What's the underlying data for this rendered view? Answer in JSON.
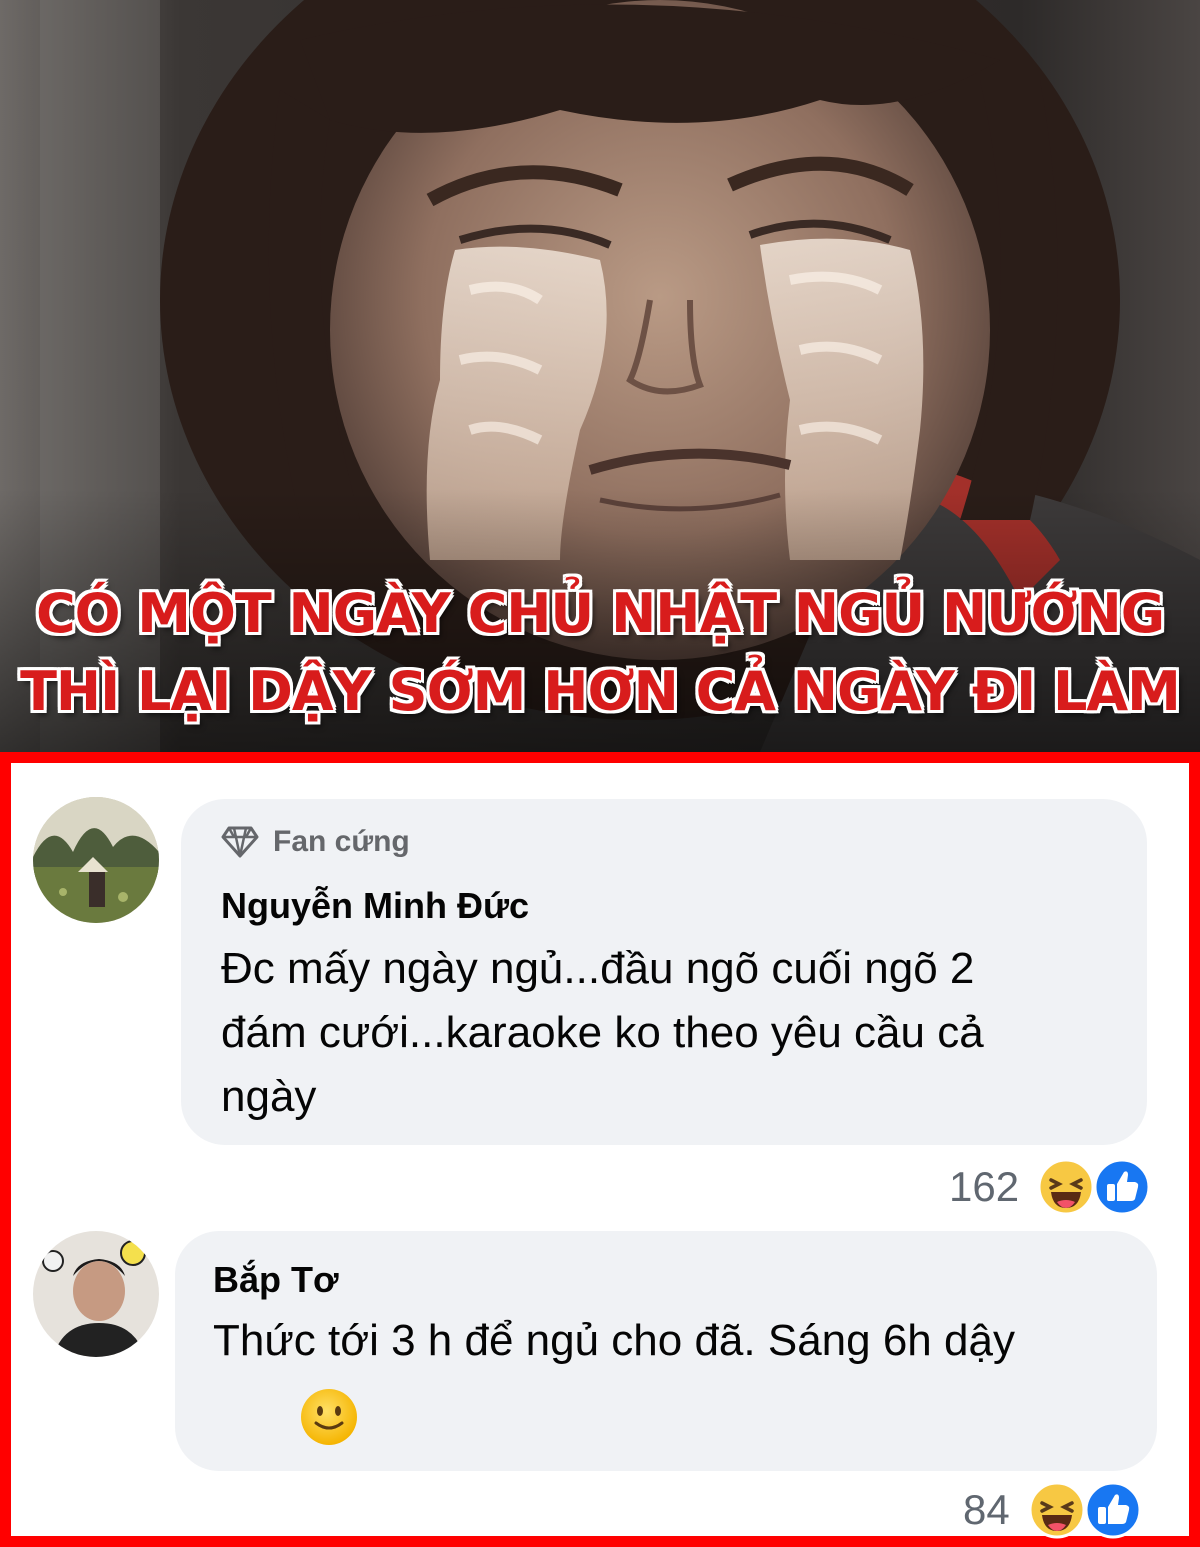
{
  "caption": {
    "line1": "CÓ MỘT NGÀY CHỦ NHẬT NGỦ NƯỚNG",
    "line2": "THÌ LẠI DẬY SỚM HƠN CẢ NGÀY ĐI LÀM"
  },
  "comments": [
    {
      "badge": "Fan cứng",
      "author": "Nguyễn Minh Đức",
      "text_lines": [
        "Đc mấy ngày ngủ...đầu ngõ cuối ngõ 2",
        "đám cưới...karaoke ko theo yêu cầu cả",
        "ngày"
      ],
      "reaction_count": "162",
      "reactions": [
        "haha-icon",
        "like-icon"
      ]
    },
    {
      "author": "Bắp Tơ",
      "text_lines": [
        "Thức tới 3 h để ngủ cho đã. Sáng 6h dậy"
      ],
      "inline_emoji": "slightly-smiling-face-icon",
      "reaction_count": "84",
      "reactions": [
        "haha-icon",
        "like-icon"
      ]
    }
  ],
  "colors": {
    "caption_text": "#d81c1c",
    "frame_border": "#ff0000",
    "bubble_bg": "#f0f2f5",
    "like_blue": "#1877f2"
  }
}
